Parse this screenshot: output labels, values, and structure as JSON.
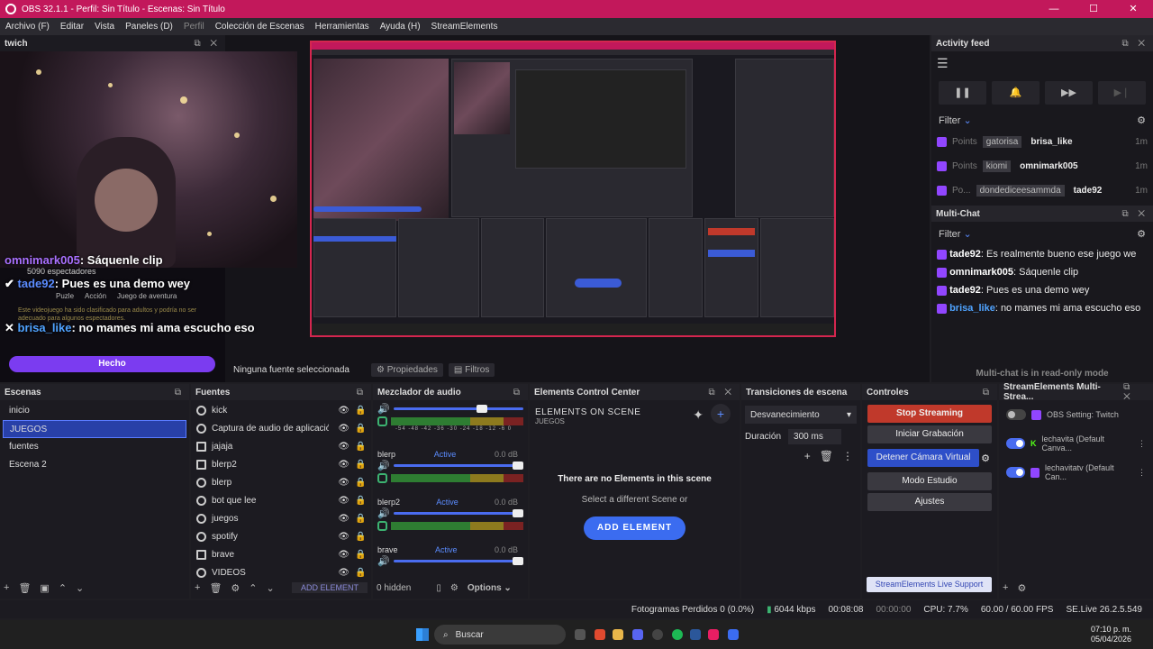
{
  "window": {
    "title": "OBS 32.1.1 - Perfil: Sin Título - Escenas: Sin Título",
    "controls": [
      "—",
      "☐",
      "✕"
    ]
  },
  "menu": [
    "Archivo (F)",
    "Editar",
    "Vista",
    "Paneles (D)",
    "Perfil",
    "Colección de Escenas",
    "Herramientas",
    "Ayuda (H)",
    "StreamElements"
  ],
  "twitch_dock": {
    "title": "twich",
    "viewers": "5090 espectadores",
    "game_tags": [
      "Puzle",
      "Acción",
      "Juego de aventura"
    ],
    "warning": "Este videojuego ha sido clasificado para adultos y podría no ser adecuado para algunos espectadores.",
    "chat": [
      {
        "user": "omnimark005",
        "text": ": Sáquenle clip"
      },
      {
        "user": "tade92",
        "text": ": Pues es una demo wey"
      },
      {
        "user": "brisa_like",
        "text": ": no mames mi ama escucho eso"
      }
    ],
    "done_button": "Hecho"
  },
  "source_toolbar": {
    "no_source": "Ninguna fuente seleccionada",
    "properties": "Propiedades",
    "filters": "Filtros"
  },
  "activity_feed": {
    "title": "Activity feed",
    "filter": "Filter",
    "items": [
      {
        "kind": "Points",
        "tag": "gatorisa",
        "user": "brisa_like",
        "time": "1m"
      },
      {
        "kind": "Points",
        "tag": "kiomi",
        "user": "omnimark005",
        "time": "1m"
      },
      {
        "kind": "Po...",
        "tag": "dondediceesammda",
        "user": "tade92",
        "time": "1m"
      }
    ]
  },
  "multichat": {
    "title": "Multi-Chat",
    "filter": "Filter",
    "lines": [
      {
        "user": "tade92",
        "text": ": Es realmente bueno ese juego we"
      },
      {
        "user": "omnimark005",
        "text": ": Sáquenle clip"
      },
      {
        "user": "tade92",
        "text": ": Pues es una demo wey"
      },
      {
        "user": "brisa_like",
        "text": ": no mames mi ama escucho eso"
      }
    ],
    "readonly": "Multi-chat is in read-only mode"
  },
  "escenas": {
    "title": "Escenas",
    "items": [
      "inicio",
      "JUEGOS",
      "fuentes",
      "Escena 2"
    ],
    "selected": "JUEGOS"
  },
  "fuentes": {
    "title": "Fuentes",
    "items": [
      "kick",
      "Captura de audio de aplicación (E",
      "jajaja",
      "blerp2",
      "blerp",
      "bot que lee",
      "juegos",
      "spotify",
      "brave",
      "VIDEOS"
    ],
    "add_element": "ADD ELEMENT"
  },
  "mixer": {
    "title": "Mezclador de audio",
    "scale": "-54 -48 -42 -36 -30 -24 -18 -12 -6 0",
    "channels": [
      {
        "name": "",
        "status": "",
        "db": ""
      },
      {
        "name": "blerp",
        "status": "Active",
        "db": "0.0 dB"
      },
      {
        "name": "blerp2",
        "status": "Active",
        "db": "0.0 dB"
      },
      {
        "name": "brave",
        "status": "Active",
        "db": "0.0 dB"
      }
    ],
    "hidden": "0 hidden",
    "options": "Options"
  },
  "ecc": {
    "title": "Elements Control Center",
    "heading": "ELEMENTS ON SCENE",
    "scene": "JUEGOS",
    "empty": "There are no Elements in this scene",
    "hint": "Select a different Scene or",
    "add": "ADD ELEMENT"
  },
  "transitions": {
    "title": "Transiciones de escena",
    "selected": "Desvanecimiento",
    "duration_label": "Duración",
    "duration": "300 ms"
  },
  "controls": {
    "title": "Controles",
    "buttons": [
      "Stop Streaming",
      "Iniciar Grabación",
      "Detener Cámara Virtual",
      "Modo Estudio",
      "Ajustes"
    ],
    "support": "StreamElements Live Support"
  },
  "se_multi": {
    "title": "StreamElements Multi-Strea...",
    "rows": [
      {
        "label": "OBS Setting: Twitch",
        "on": false
      },
      {
        "label": "lechavita (Default Canva...",
        "on": true
      },
      {
        "label": "lechavitatv (Default Can...",
        "on": true
      }
    ]
  },
  "status": {
    "dropped": "Fotogramas Perdidos 0 (0.0%)",
    "bitrate": "6044 kbps",
    "stream_time": "00:08:08",
    "rec_time": "00:00:00",
    "cpu": "CPU: 7.7%",
    "fps": "60.00 / 60.00 FPS",
    "version": "SE.Live 26.2.5.549"
  },
  "taskbar": {
    "search": "Buscar",
    "time": "07:10 p. m.",
    "date": "05/04/2026"
  },
  "colors": {
    "accent": "#c2185b",
    "blue": "#3b6cf0",
    "twitch": "#9146ff"
  }
}
